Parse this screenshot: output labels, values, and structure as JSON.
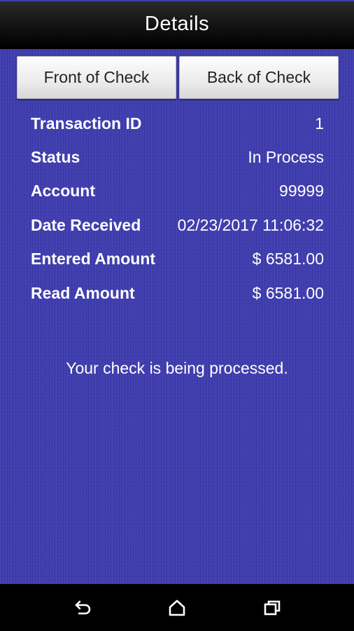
{
  "header": {
    "title": "Details"
  },
  "tabs": [
    {
      "label": "Front of Check"
    },
    {
      "label": "Back of Check"
    }
  ],
  "details": [
    {
      "label": "Transaction ID",
      "value": "1"
    },
    {
      "label": "Status",
      "value": "In Process"
    },
    {
      "label": "Account",
      "value": "99999"
    },
    {
      "label": "Date Received",
      "value": "02/23/2017 11:06:32"
    },
    {
      "label": "Entered Amount",
      "value": "$ 6581.00"
    },
    {
      "label": "Read Amount",
      "value": "$ 6581.00"
    }
  ],
  "message": "Your check is being processed.",
  "navbar": {
    "icons": [
      "back-icon",
      "home-icon",
      "recent-apps-icon"
    ]
  },
  "colors": {
    "background": "#3f3dae",
    "titlebar": "#000000",
    "text": "#ffffff"
  }
}
